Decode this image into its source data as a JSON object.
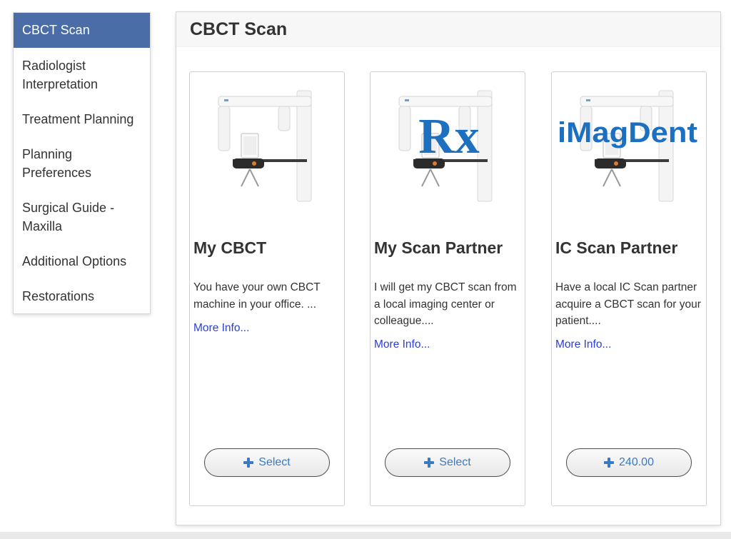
{
  "sidebar": {
    "items": [
      {
        "label": "CBCT Scan"
      },
      {
        "label": "Radiologist Interpretation"
      },
      {
        "label": "Treatment Planning"
      },
      {
        "label": "Planning Preferences"
      },
      {
        "label": "Surgical Guide - Maxilla"
      },
      {
        "label": "Additional Options"
      },
      {
        "label": "Restorations"
      }
    ],
    "active_color": "#4a6da7"
  },
  "panel": {
    "title": "CBCT Scan"
  },
  "cards": [
    {
      "title": "My CBCT",
      "description": "You have your own CBCT machine in your office. ...",
      "link": "More Info...",
      "button": "Select",
      "overlay": ""
    },
    {
      "title": "My Scan Partner",
      "description": "I will get my CBCT scan from a local imaging center or colleague....",
      "link": "More Info...",
      "button": "Select",
      "overlay": "Rx"
    },
    {
      "title": "IC Scan Partner",
      "description": "Have a local IC Scan partner acquire a CBCT scan for your patient....",
      "link": "More Info...",
      "button": "240.00",
      "overlay": "iMagDent"
    }
  ],
  "colors": {
    "link": "#2b3fd6",
    "button_text": "#3b7ac2",
    "overlay_blue": "#1d6fc0"
  }
}
